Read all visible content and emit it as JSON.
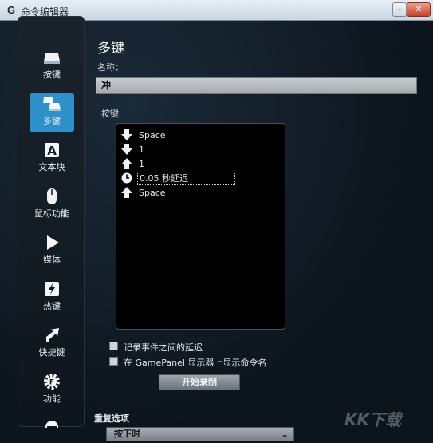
{
  "window": {
    "title": "命令编辑器",
    "logo": "G",
    "minimize": "–",
    "close": "✕"
  },
  "sidebar": {
    "items": [
      {
        "label": "按键",
        "icon": "key-icon",
        "active": false
      },
      {
        "label": "多键",
        "icon": "multikey-icon",
        "active": true
      },
      {
        "label": "文本块",
        "icon": "text-block-icon",
        "active": false
      },
      {
        "label": "鼠标功能",
        "icon": "mouse-icon",
        "active": false
      },
      {
        "label": "媒体",
        "icon": "play-icon",
        "active": false
      },
      {
        "label": "热键",
        "icon": "hotkey-icon",
        "active": false
      },
      {
        "label": "快捷键",
        "icon": "shortcut-arrow-icon",
        "active": false
      },
      {
        "label": "功能",
        "icon": "function-gear-icon",
        "active": false
      }
    ]
  },
  "main": {
    "title": "多键",
    "name_label": "名称：",
    "name_value": "冲",
    "keys_label": "按键",
    "keys": [
      {
        "icon": "arrow-down-icon",
        "text": "Space"
      },
      {
        "icon": "arrow-down-icon",
        "text": "1"
      },
      {
        "icon": "arrow-up-icon",
        "text": "1"
      },
      {
        "icon": "clock-icon",
        "text": "0.05 秒延迟",
        "selected": true
      },
      {
        "icon": "arrow-up-icon",
        "text": "Space"
      }
    ],
    "options": [
      {
        "label": "记录事件之间的延迟",
        "checked": false
      },
      {
        "label": "在 GamePanel 显示器上显示命令名",
        "checked": false
      }
    ],
    "record_button": "开始录制",
    "repeat_label": "重复选项",
    "repeat_value": "按下时"
  },
  "watermark": "KK下载",
  "colors": {
    "accent": "#2f8fc9",
    "background": "#0c141c",
    "list_bg": "#000000"
  }
}
